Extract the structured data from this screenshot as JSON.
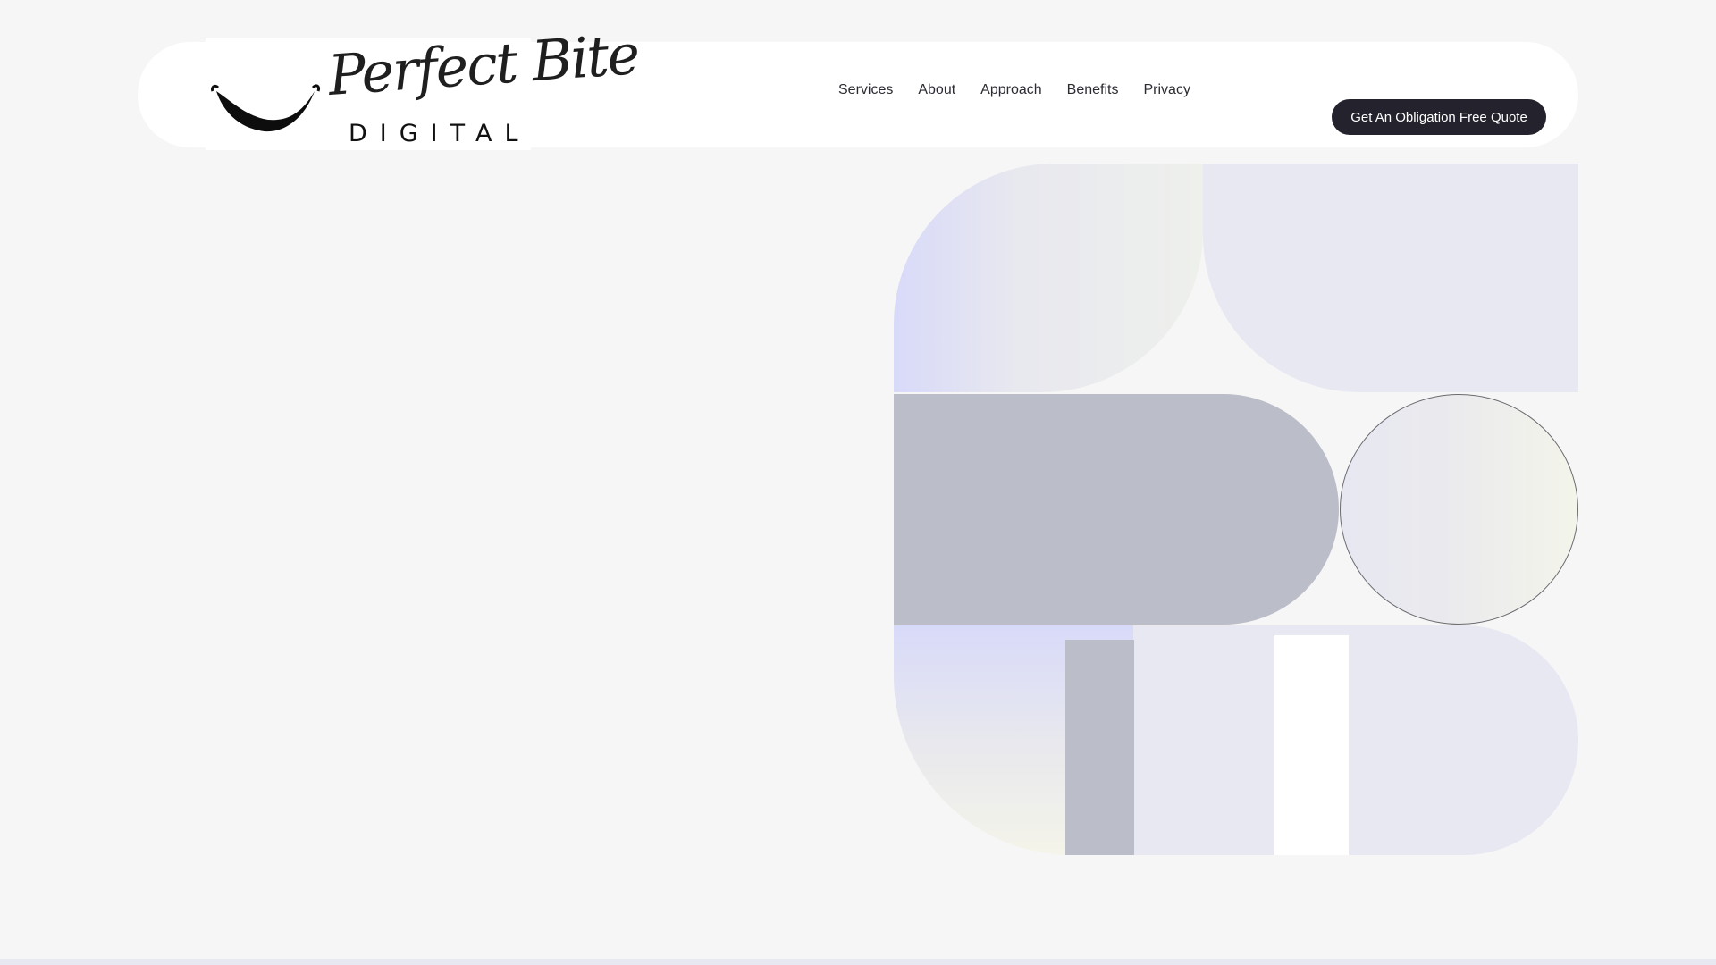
{
  "brand": {
    "script": "Perfect Bite",
    "subtitle": "DIGITAL"
  },
  "nav": {
    "items": [
      {
        "label": "Services"
      },
      {
        "label": "About"
      },
      {
        "label": "Approach"
      },
      {
        "label": "Benefits"
      },
      {
        "label": "Privacy"
      }
    ]
  },
  "cta": {
    "label": "Get An Obligation Free Quote"
  },
  "colors": {
    "background": "#f6f6f6",
    "header": "#ffffff",
    "cta": "#24222c",
    "lavender": "#e8e8f2",
    "gray": "#bbbdc9"
  }
}
